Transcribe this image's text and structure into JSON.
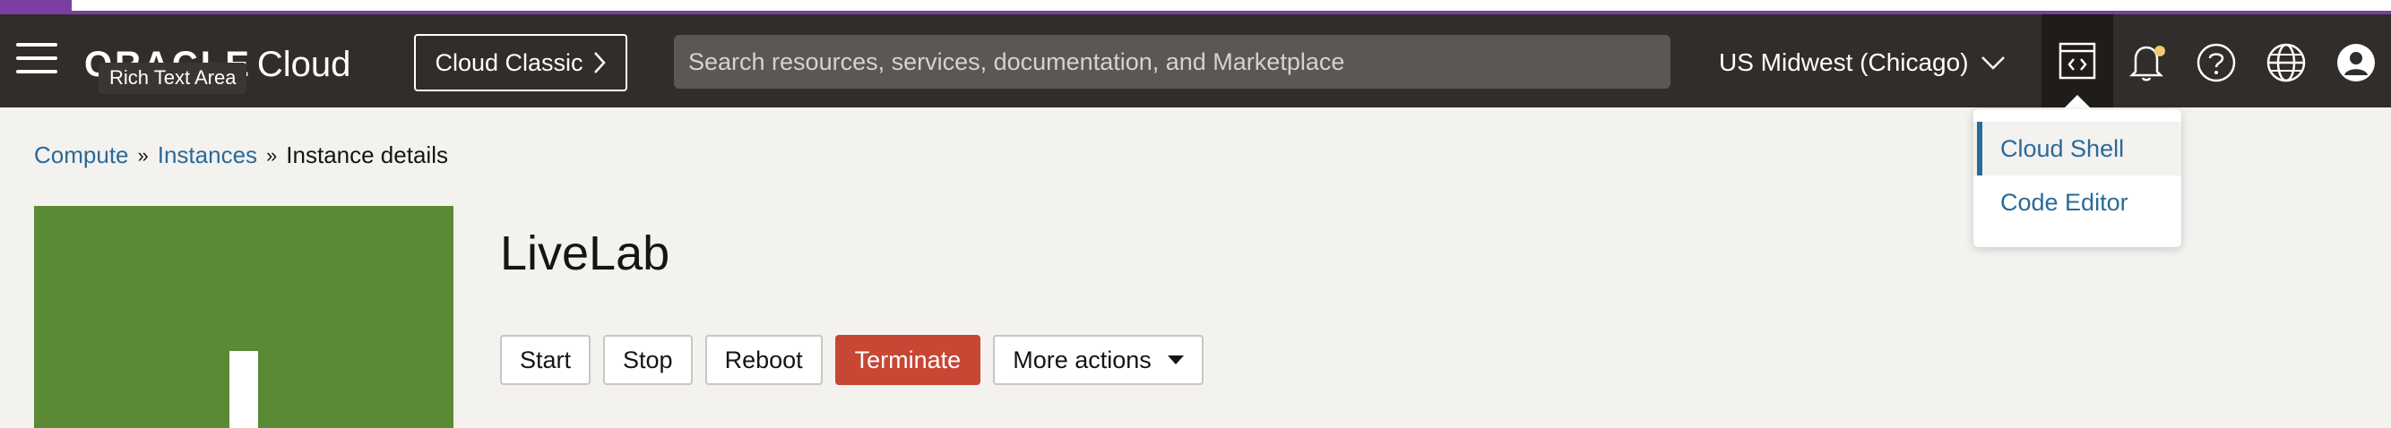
{
  "header": {
    "logo_oracle": "ORACLE",
    "logo_cloud": "Cloud",
    "tooltip": "Rich Text Area",
    "cloud_classic_label": "Cloud Classic",
    "search_placeholder": "Search resources, services, documentation, and Marketplace",
    "region": "US Midwest (Chicago)",
    "icons": [
      "menu-icon",
      "chevron-right-icon",
      "chevron-down-icon",
      "developer-tools-icon",
      "bell-icon",
      "help-icon",
      "globe-icon",
      "user-icon"
    ],
    "notification_dot_color": "#f0cc71"
  },
  "breadcrumb": {
    "items": [
      "Compute",
      "Instances"
    ],
    "current": "Instance details"
  },
  "instance": {
    "title": "LiveLab",
    "icon_color": "#5b8a34"
  },
  "actions": {
    "start": "Start",
    "stop": "Stop",
    "reboot": "Reboot",
    "terminate": "Terminate",
    "more": "More actions"
  },
  "dev_menu": {
    "items": [
      "Cloud Shell",
      "Code Editor"
    ]
  },
  "colors": {
    "header_bg": "#312d2a",
    "link": "#2a6a98",
    "danger": "#c74634",
    "accent": "#7a3fa0"
  }
}
